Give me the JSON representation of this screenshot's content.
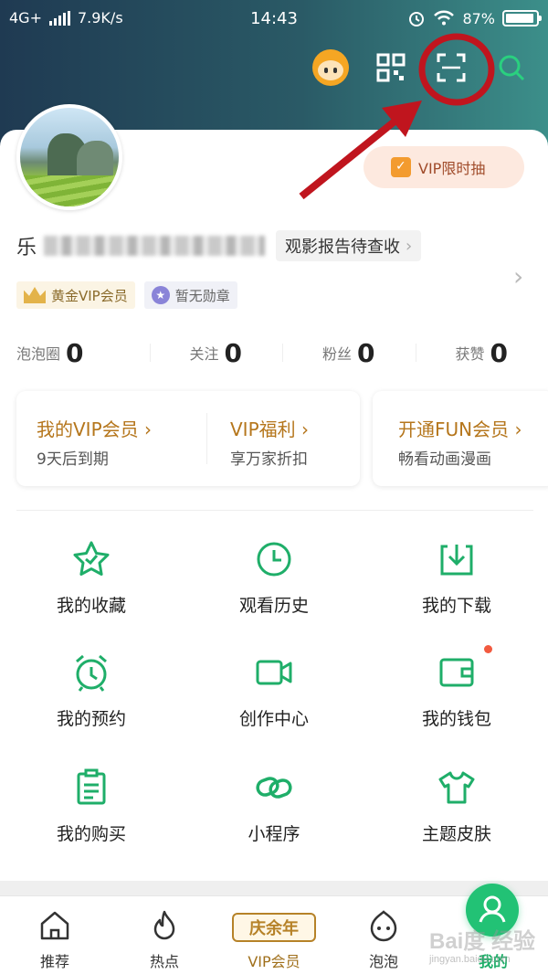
{
  "status_bar": {
    "network": "4G+",
    "speed": "7.9K/s",
    "time": "14:43",
    "battery": "87%"
  },
  "header": {
    "icons": [
      "mascot-avatar-icon",
      "qr-code-icon",
      "scan-icon",
      "search-icon"
    ]
  },
  "profile": {
    "name_prefix": "乐",
    "report_label": "观影报告待查收",
    "vip_draw_label": "VIP限时抽",
    "badges": [
      {
        "label": "黄金VIP会员"
      },
      {
        "label": "暂无勋章"
      }
    ],
    "stats": [
      {
        "label": "泡泡圈",
        "value": "0"
      },
      {
        "label": "关注",
        "value": "0"
      },
      {
        "label": "粉丝",
        "value": "0"
      },
      {
        "label": "获赞",
        "value": "0"
      }
    ]
  },
  "vip_cards": [
    {
      "title": "我的VIP会员 ›",
      "subtitle": "9天后到期"
    },
    {
      "title": "VIP福利 ›",
      "subtitle": "享万家折扣"
    },
    {
      "title": "开通FUN会员 ›",
      "subtitle": "畅看动画漫画"
    }
  ],
  "grid": [
    {
      "label": "我的收藏",
      "icon": "star-icon"
    },
    {
      "label": "观看历史",
      "icon": "clock-icon"
    },
    {
      "label": "我的下载",
      "icon": "download-icon"
    },
    {
      "label": "我的预约",
      "icon": "alarm-icon"
    },
    {
      "label": "创作中心",
      "icon": "video-camera-icon"
    },
    {
      "label": "我的钱包",
      "icon": "wallet-icon"
    },
    {
      "label": "我的购买",
      "icon": "clipboard-icon"
    },
    {
      "label": "小程序",
      "icon": "link-icon"
    },
    {
      "label": "主题皮肤",
      "icon": "tshirt-icon"
    }
  ],
  "tabbar": [
    {
      "label": "推荐",
      "icon": "home-icon"
    },
    {
      "label": "热点",
      "icon": "flame-icon"
    },
    {
      "label": "VIP会员",
      "icon": "vip-tag-icon",
      "tag": "庆余年"
    },
    {
      "label": "泡泡",
      "icon": "bubble-face-icon"
    },
    {
      "label": "我的",
      "icon": "user-icon"
    }
  ],
  "watermark": {
    "line1": "Bai度 经验",
    "line2": "jingyan.baidu.com"
  },
  "colors": {
    "accent_green": "#22c275",
    "vip_gold": "#b5761c",
    "annotation_red": "#c0151e",
    "header_dark": "#1f3a52",
    "header_teal": "#3c8f8a"
  }
}
